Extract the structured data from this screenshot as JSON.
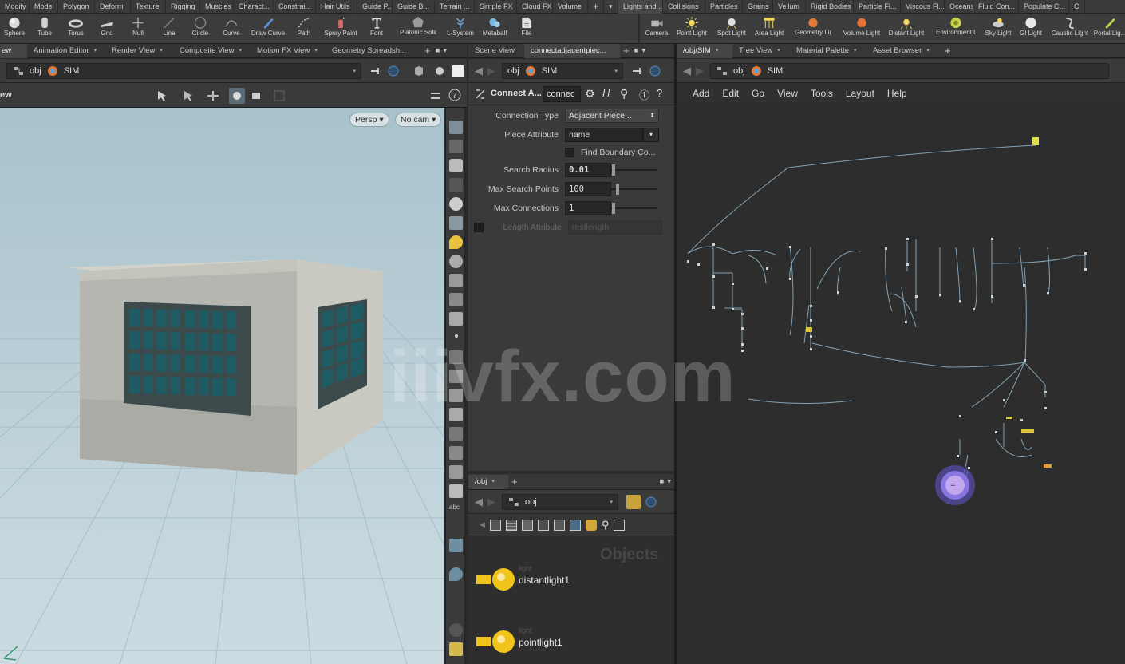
{
  "shelf_tabs": [
    "Modify",
    "Model",
    "Polygon",
    "Deform",
    "Texture",
    "Rigging",
    "Muscles",
    "Charact...",
    "Constrai...",
    "Hair Utils",
    "Guide P...",
    "Guide B...",
    "Terrain ...",
    "Simple FX",
    "Cloud FX",
    "Volume",
    "+",
    "Lights and ...",
    "Collisions",
    "Particles",
    "Grains",
    "Vellum",
    "Rigid Bodies",
    "Particle Fl...",
    "Viscous Fl...",
    "Oceans",
    "Fluid Con...",
    "Populate C...",
    "C"
  ],
  "shelf_tools_left": [
    "Sphere",
    "Tube",
    "Torus",
    "Grid",
    "Null",
    "Line",
    "Circle",
    "Curve",
    "Draw Curve",
    "Path",
    "Spray Paint",
    "Font",
    "Platonic Solids",
    "L-System",
    "Metaball",
    "File"
  ],
  "shelf_tools_right": [
    "Camera",
    "Point Light",
    "Spot Light",
    "Area Light",
    "Geometry Light",
    "Volume Light",
    "Distant Light",
    "Environment Light",
    "Sky Light",
    "GI Light",
    "Caustic Light",
    "Portal Lig..."
  ],
  "left_pane": {
    "tabs": [
      "ew",
      "Animation Editor",
      "Render View",
      "Composite View",
      "Motion FX View",
      "Geometry Spreadsh..."
    ],
    "path": [
      "obj",
      "SIM"
    ],
    "view_label": "ew",
    "persp_button": "Persp",
    "cam_button": "No cam"
  },
  "mid_pane": {
    "tabs": [
      "Scene View",
      "connectadjacentpiec..."
    ],
    "path": [
      "obj",
      "SIM"
    ],
    "node_type": "Connect A...",
    "node_name": "connec",
    "params": [
      {
        "label": "Connection Type",
        "value": "Adjacent Piece..."
      },
      {
        "label": "Piece Attribute",
        "value": "name"
      },
      {
        "label": "",
        "value": "Find Boundary Co..."
      },
      {
        "label": "Search Radius",
        "value": "0.01"
      },
      {
        "label": "Max Search Points",
        "value": "100"
      },
      {
        "label": "Max Connections",
        "value": "1"
      },
      {
        "label": "Length Attribute",
        "value": "restlength"
      }
    ],
    "tree_tab": "/obj",
    "tree_path": "obj",
    "objects_heading": "Objects",
    "objects": [
      {
        "type": "light",
        "name": "distantlight1"
      },
      {
        "type": "light",
        "name": "pointlight1"
      }
    ]
  },
  "right_pane": {
    "tabs": [
      "/obj/SIM",
      "Tree View",
      "Material Palette",
      "Asset Browser"
    ],
    "path": [
      "obj",
      "SIM"
    ],
    "menu": [
      "Add",
      "Edit",
      "Go",
      "View",
      "Tools",
      "Layout",
      "Help"
    ]
  },
  "watermark": "iiivfx.com",
  "colors": {
    "accent": "#f0c419",
    "selection": "#7b6bd6",
    "wire": "#9fb8c8"
  }
}
